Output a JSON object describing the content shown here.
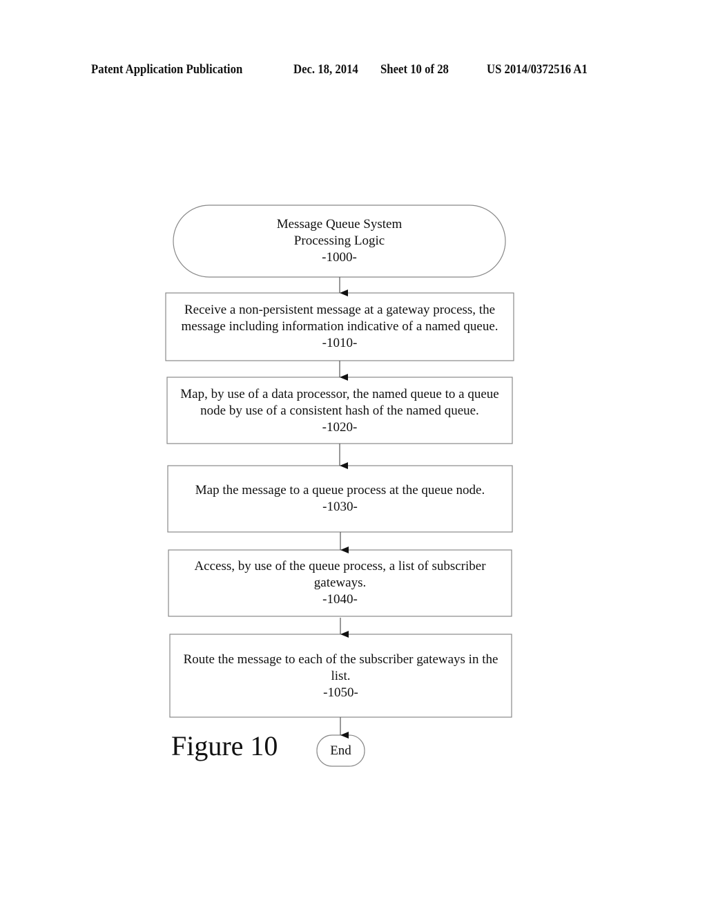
{
  "header": {
    "publication": "Patent Application Publication",
    "date": "Dec. 18, 2014",
    "sheet": "Sheet 10 of 28",
    "patent_number": "US 2014/0372516 A1"
  },
  "figure_label": "Figure 10",
  "flowchart": {
    "start": {
      "line1": "Message Queue System",
      "line2": "Processing Logic",
      "ref": "-1000-"
    },
    "steps": [
      {
        "line1": "Receive a non-persistent message at a gateway process, the",
        "line2": "message including information indicative of a named queue.",
        "ref": "-1010-"
      },
      {
        "line1": "Map, by use of a data processor, the named queue to a queue",
        "line2": "node by use of a consistent hash of the named queue.",
        "ref": "-1020-"
      },
      {
        "line1": "Map the message to a queue process at the queue node.",
        "line2": "",
        "ref": "-1030-"
      },
      {
        "line1": "Access, by use of the queue process, a list of subscriber",
        "line2": "gateways.",
        "ref": "-1040-"
      },
      {
        "line1": "Route the message to each of the subscriber gateways in the",
        "line2": "list.",
        "ref": "-1050-"
      }
    ],
    "end": {
      "label": "End"
    }
  }
}
